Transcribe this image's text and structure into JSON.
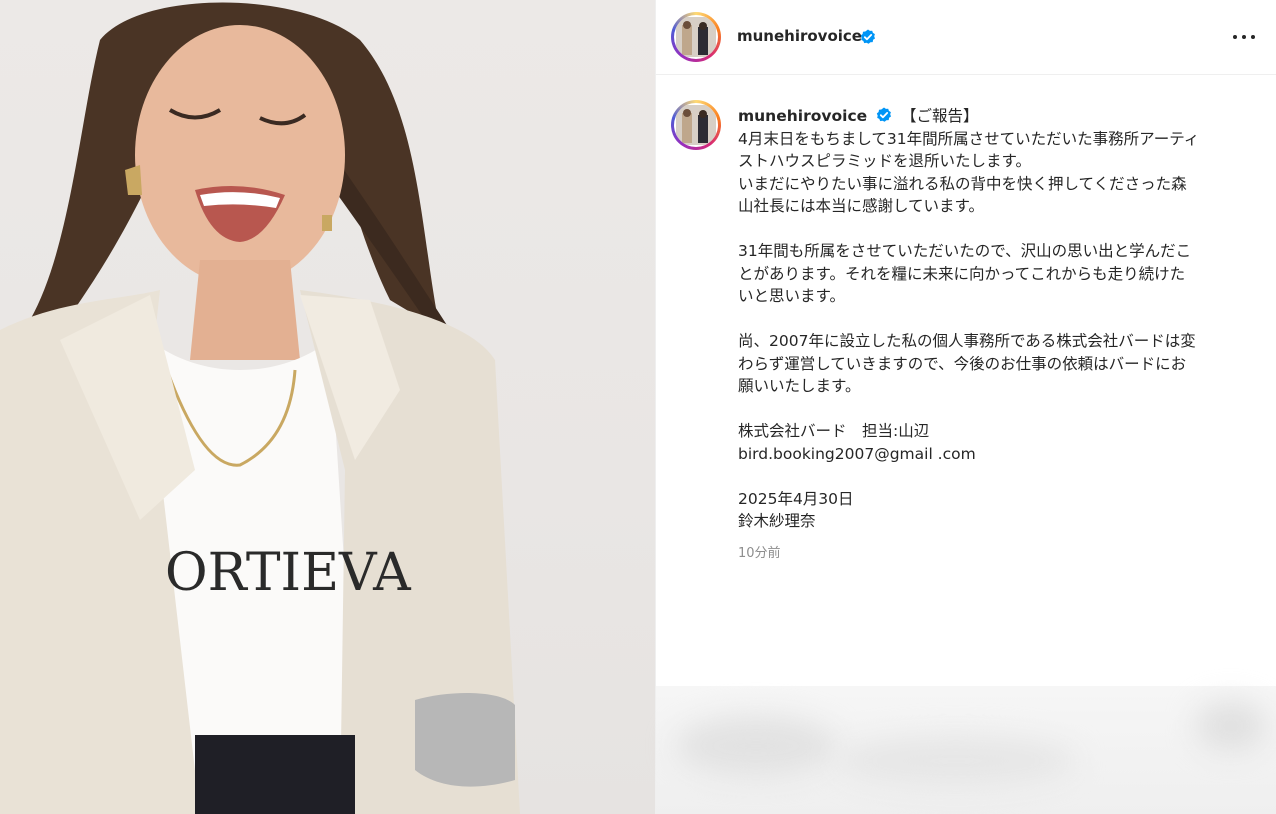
{
  "post": {
    "username": "munehirovoice",
    "more_icon": "more-horizontal-icon",
    "verified_icon": "verified-badge-icon",
    "caption_title": "【ご報告】",
    "caption_lines": [
      "4月末日をもちまして31年間所属させていただいた事務所アーティ",
      "ストハウスピラミッドを退所いたします。",
      "いまだにやりたい事に溢れる私の背中を快く押してくださった森",
      "山社長には本当に感謝しています。",
      "",
      "31年間も所属をさせていただいたので、沢山の思い出と学んだこ",
      "とがあります。それを糧に未来に向かってこれからも走り続けた",
      "いと思います。",
      "",
      "尚、2007年に設立した私の個人事務所である株式会社バードは変",
      "わらず運営していきますので、今後のお仕事の依頼はバードにお",
      "願いいたします。",
      "",
      "株式会社バード　担当:山辺",
      "bird.booking2007@gmail .com",
      "",
      "2025年4月30日",
      "鈴木紗理奈"
    ],
    "timestamp": "10分前",
    "tshirt_print": "ORTIEVA"
  },
  "colors": {
    "verified_blue": "#0095f6",
    "text_secondary": "#8e8e8e",
    "text_primary": "#262626"
  }
}
